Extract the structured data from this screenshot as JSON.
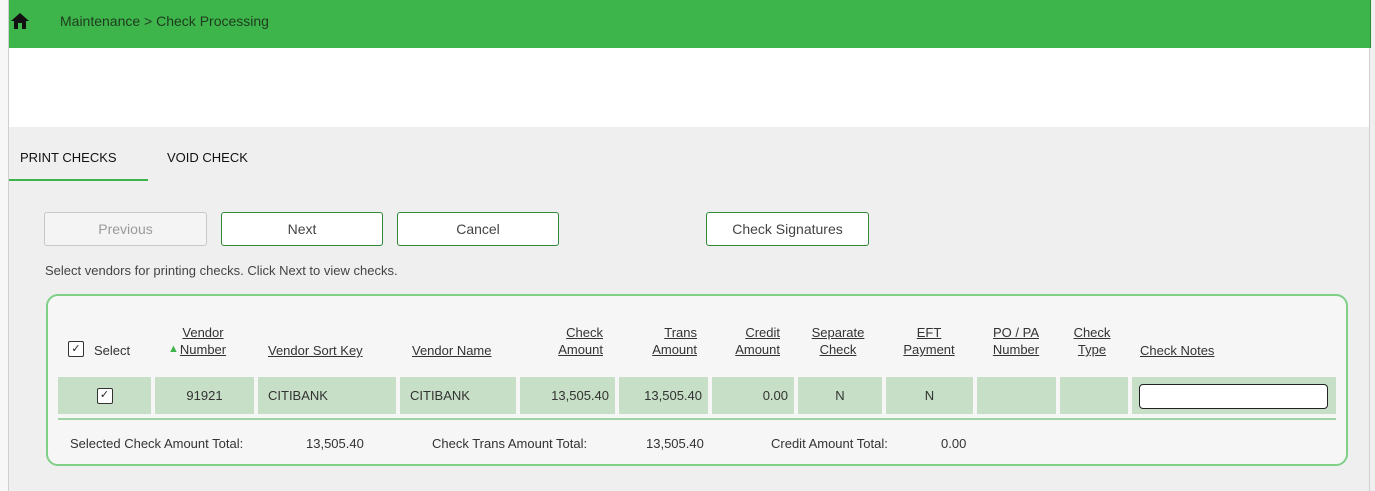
{
  "header": {
    "breadcrumb": "Maintenance > Check Processing",
    "home_icon": "home-icon",
    "bar_color": "#3db54a"
  },
  "tabs": [
    {
      "label": "PRINT CHECKS",
      "active": true
    },
    {
      "label": "VOID CHECK",
      "active": false
    }
  ],
  "buttons": {
    "previous": "Previous",
    "next": "Next",
    "cancel": "Cancel",
    "check_signatures": "Check Signatures"
  },
  "instructions": "Select vendors for printing checks. Click Next to view checks.",
  "table": {
    "select_all_label": "Select",
    "sort_indicator": "▲",
    "headers": {
      "vendor_number": [
        "Vendor",
        "Number"
      ],
      "vendor_sort_key": "Vendor Sort Key",
      "vendor_name": "Vendor Name",
      "check_amount": [
        "Check",
        "Amount"
      ],
      "trans_amount": [
        "Trans",
        "Amount"
      ],
      "credit_amount": [
        "Credit",
        "Amount"
      ],
      "separate_check": [
        "Separate",
        "Check"
      ],
      "eft_payment": [
        "EFT",
        "Payment"
      ],
      "po_pa_number": [
        "PO / PA",
        "Number"
      ],
      "check_type": [
        "Check",
        "Type"
      ],
      "check_notes": "Check Notes"
    },
    "rows": [
      {
        "selected": true,
        "vendor_number": "91921",
        "vendor_sort_key": "CITIBANK",
        "vendor_name": "CITIBANK",
        "check_amount": "13,505.40",
        "trans_amount": "13,505.40",
        "credit_amount": "0.00",
        "separate_check": "N",
        "eft_payment": "N",
        "po_pa_number": "",
        "check_type": "",
        "check_notes": ""
      }
    ],
    "row_color": "#c6dfc6"
  },
  "totals": {
    "selected_label": "Selected Check Amount Total:",
    "selected_value": "13,505.40",
    "trans_label": "Check Trans Amount Total:",
    "trans_value": "13,505.40",
    "credit_label": "Credit Amount Total:",
    "credit_value": "0.00"
  }
}
